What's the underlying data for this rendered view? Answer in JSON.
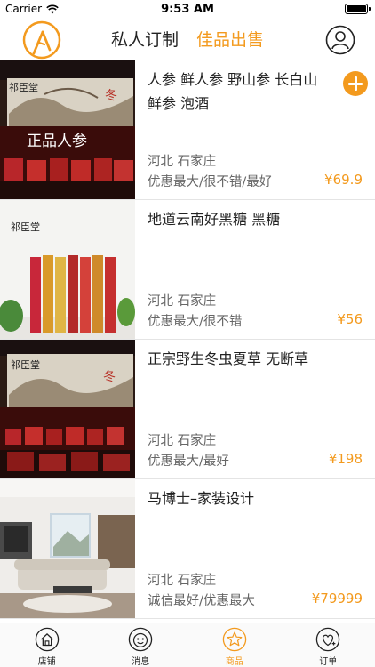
{
  "status_bar": {
    "carrier": "Carrier",
    "time": "9:53 AM",
    "battery_level": 1.0
  },
  "header": {
    "tab_private": "私人订制",
    "tab_sale": "佳品出售",
    "active_tab": "tab_sale"
  },
  "products": [
    {
      "title": "人参 鲜人参 野山参 长白山鲜参 泡酒",
      "title_lines": [
        "人参 鲜人参 野山参 长白山",
        "鲜参 泡酒"
      ],
      "location": "河北 石家庄",
      "tags": "优惠最大/很不错/最好",
      "price": "¥69.9",
      "image_brand": "祁臣堂",
      "image_caption": "正品人参"
    },
    {
      "title": "地道云南好黑糖 黑糖",
      "title_lines": [
        "地道云南好黑糖 黑糖"
      ],
      "location": "河北 石家庄",
      "tags": "优惠最大/很不错",
      "price": "¥56",
      "image_brand": "祁臣堂"
    },
    {
      "title": "正宗野生冬虫夏草 无断草",
      "title_lines": [
        "正宗野生冬虫夏草 无断草"
      ],
      "location": "河北 石家庄",
      "tags": "优惠最大/最好",
      "price": "¥198",
      "image_brand": "祁臣堂"
    },
    {
      "title": "马博士–家装设计",
      "title_lines": [
        "马博士–家装设计"
      ],
      "location": "河北 石家庄",
      "tags": "诚信最好/优惠最大",
      "price": "¥79999"
    }
  ],
  "tabbar": [
    {
      "label": "店铺",
      "icon": "home-icon"
    },
    {
      "label": "消息",
      "icon": "message-icon"
    },
    {
      "label": "商品",
      "icon": "star-icon",
      "active": true
    },
    {
      "label": "订单",
      "icon": "order-icon"
    }
  ],
  "colors": {
    "accent": "#f39a1e",
    "text": "#222222",
    "muted": "#666666"
  }
}
